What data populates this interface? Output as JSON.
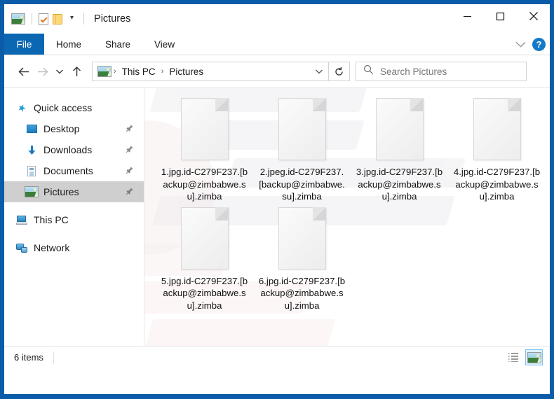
{
  "window": {
    "title": "Pictures",
    "quick_access_toolbar": [
      {
        "name": "picture-properties-icon",
        "label": "Properties"
      },
      {
        "name": "document-check-icon",
        "label": "Properties"
      },
      {
        "name": "new-folder-icon",
        "label": "New folder"
      },
      {
        "name": "customize-caret-icon",
        "label": "▾"
      }
    ],
    "caption": {
      "minimize": "—",
      "maximize": "□",
      "close": "✕"
    }
  },
  "ribbon": {
    "file_tab": "File",
    "tabs": [
      "Home",
      "Share",
      "View"
    ],
    "expand_label": "∨",
    "help_label": "?"
  },
  "navbar": {
    "back_label": "←",
    "forward_label": "→",
    "recent_label": "∨",
    "up_label": "↑",
    "breadcrumbs": [
      "This PC",
      "Pictures"
    ],
    "separator": "›",
    "dropdown_label": "∨",
    "refresh_label": "↺"
  },
  "search": {
    "placeholder": "Search Pictures",
    "value": ""
  },
  "sidebar": {
    "items": [
      {
        "label": "Quick access",
        "icon": "star-icon",
        "indent": 0,
        "pinned": false,
        "selected": false
      },
      {
        "label": "Desktop",
        "icon": "desktop-icon",
        "indent": 1,
        "pinned": true,
        "selected": false
      },
      {
        "label": "Downloads",
        "icon": "download-icon",
        "indent": 1,
        "pinned": true,
        "selected": false
      },
      {
        "label": "Documents",
        "icon": "document-icon",
        "indent": 1,
        "pinned": true,
        "selected": false
      },
      {
        "label": "Pictures",
        "icon": "pictures-icon",
        "indent": 1,
        "pinned": true,
        "selected": true
      },
      {
        "label": "This PC",
        "icon": "this-pc-icon",
        "indent": 0,
        "pinned": false,
        "selected": false
      },
      {
        "label": "Network",
        "icon": "network-icon",
        "indent": 0,
        "pinned": false,
        "selected": false
      }
    ],
    "pin_glyph": "📌"
  },
  "files": [
    {
      "name": "1.jpg.id-C279F237.[backup@zimbabwe.su].zimba",
      "icon": "generic-file-icon"
    },
    {
      "name": "2.jpeg.id-C279F237.[backup@zimbabwe.su].zimba",
      "icon": "generic-file-icon"
    },
    {
      "name": "3.jpg.id-C279F237.[backup@zimbabwe.su].zimba",
      "icon": "generic-file-icon"
    },
    {
      "name": "4.jpg.id-C279F237.[backup@zimbabwe.su].zimba",
      "icon": "generic-file-icon"
    },
    {
      "name": "5.jpg.id-C279F237.[backup@zimbabwe.su].zimba",
      "icon": "generic-file-icon"
    },
    {
      "name": "6.jpg.id-C279F237.[backup@zimbabwe.su].zimba",
      "icon": "generic-file-icon"
    }
  ],
  "statusbar": {
    "item_count": "6 items",
    "views": [
      {
        "name": "details-view-button",
        "active": false
      },
      {
        "name": "large-icons-view-button",
        "active": true
      }
    ]
  },
  "colors": {
    "window_border": "#0b5ca8",
    "file_tab_blue": "#0b67b2",
    "selection_gray": "#cfcfcf",
    "help_blue": "#1479c8",
    "view_active_border": "#7fc4ef"
  }
}
